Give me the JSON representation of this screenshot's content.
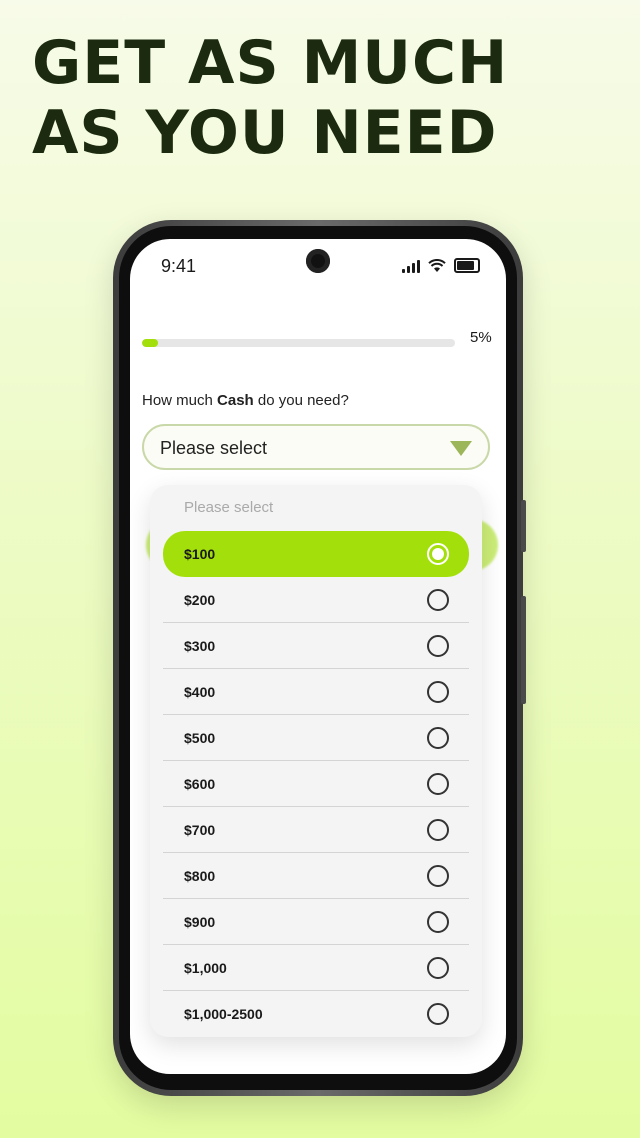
{
  "headline": {
    "line1": "GET AS MUCH",
    "line2": "AS YOU NEED"
  },
  "status_bar": {
    "time": "9:41",
    "icons": [
      "cellular-signal-icon",
      "wifi-icon",
      "battery-icon"
    ]
  },
  "progress": {
    "value": 0.05,
    "label": "5%"
  },
  "question": {
    "prefix": "How much ",
    "bold": "Cash",
    "suffix": " do you need?"
  },
  "select": {
    "value": "Please select"
  },
  "dropdown": {
    "placeholder": "Please select",
    "options": [
      {
        "label": "$100",
        "selected": true
      },
      {
        "label": "$200",
        "selected": false
      },
      {
        "label": "$300",
        "selected": false
      },
      {
        "label": "$400",
        "selected": false
      },
      {
        "label": "$500",
        "selected": false
      },
      {
        "label": "$600",
        "selected": false
      },
      {
        "label": "$700",
        "selected": false
      },
      {
        "label": "$800",
        "selected": false
      },
      {
        "label": "$900",
        "selected": false
      },
      {
        "label": "$1,000",
        "selected": false
      },
      {
        "label": "$1,000-2500",
        "selected": false
      }
    ]
  },
  "colors": {
    "accent": "#a3e00b",
    "headline": "#1c2b0f"
  }
}
